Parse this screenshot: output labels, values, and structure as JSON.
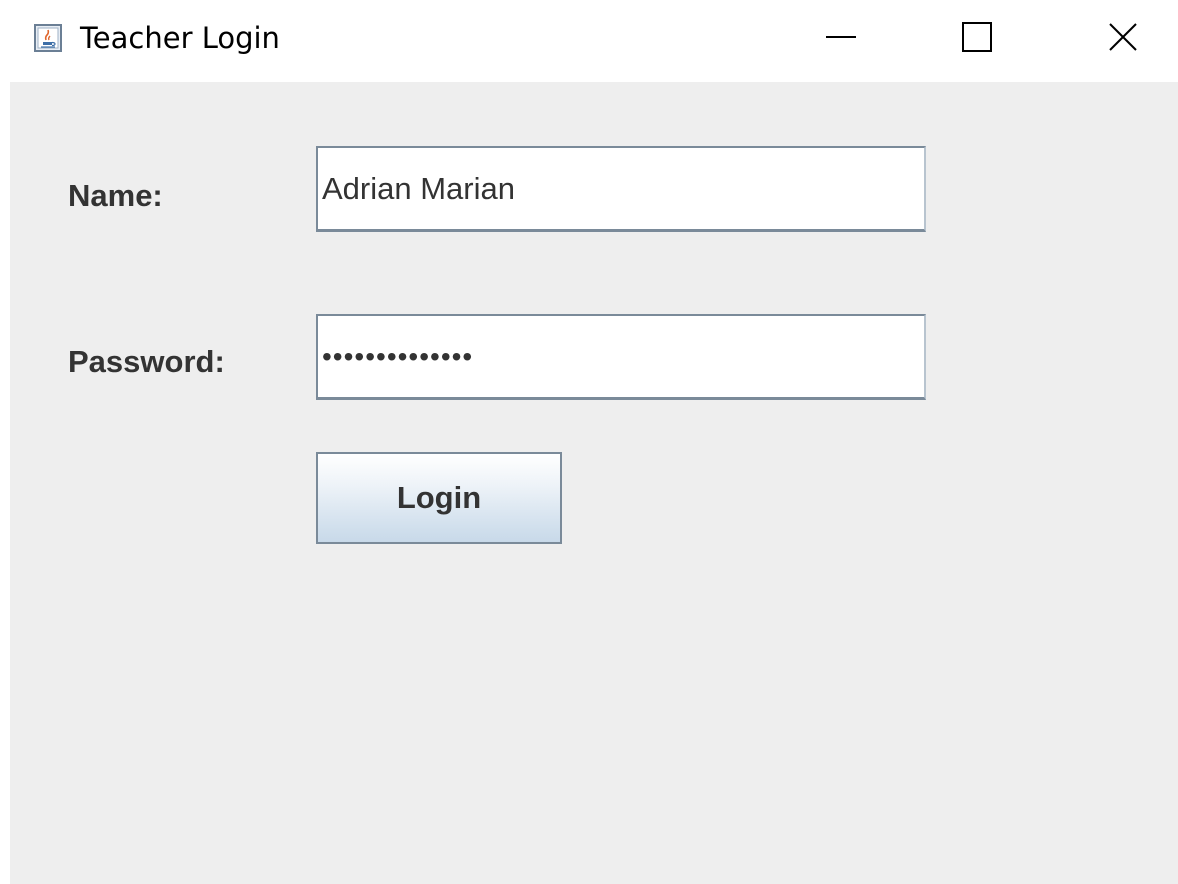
{
  "window": {
    "title": "Teacher Login",
    "app_icon": "java-cup-icon",
    "controls": {
      "minimize_icon": "minimize-icon",
      "maximize_icon": "maximize-icon",
      "close_icon": "close-icon"
    }
  },
  "form": {
    "name_label": "Name:",
    "name_value": "Adrian Marian",
    "password_label": "Password:",
    "password_masked": "••••••••••••••",
    "login_label": "Login"
  },
  "colors": {
    "content_background": "#eeeeee",
    "field_border": "#7a8a99",
    "label_text": "#333333"
  }
}
